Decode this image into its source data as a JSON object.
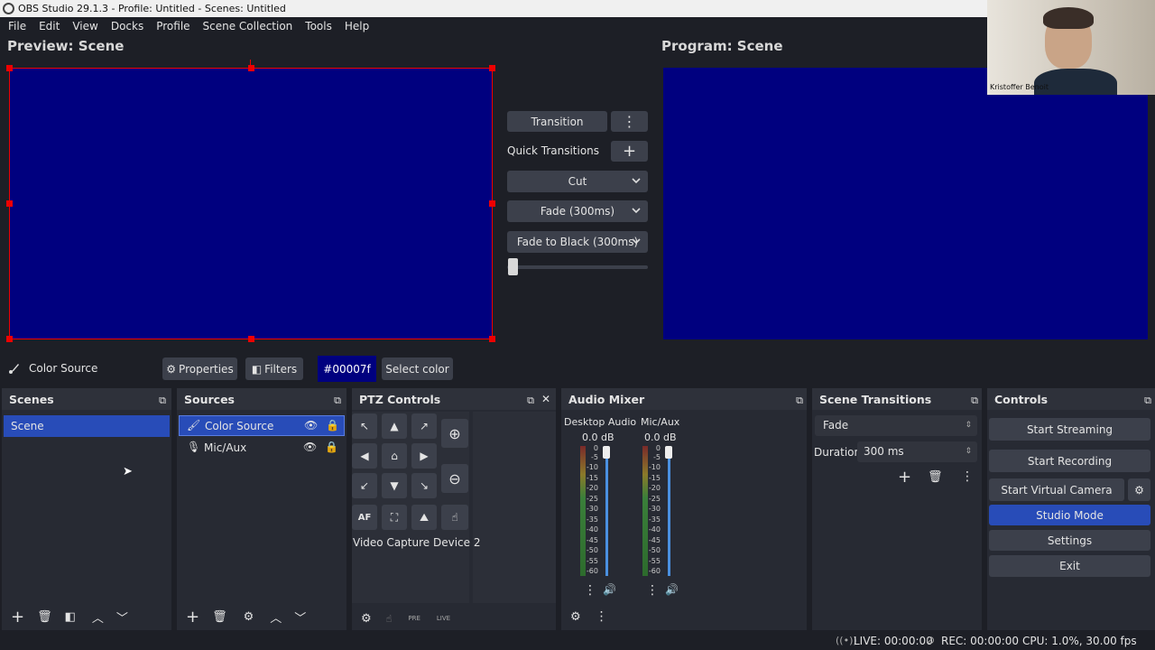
{
  "window": {
    "title": "OBS Studio 29.1.3 - Profile: Untitled - Scenes: Untitled"
  },
  "menu": [
    "File",
    "Edit",
    "View",
    "Docks",
    "Profile",
    "Scene Collection",
    "Tools",
    "Help"
  ],
  "preview": {
    "label": "Preview: Scene",
    "color": "#00007f"
  },
  "program": {
    "label": "Program: Scene",
    "color": "#00007f"
  },
  "transition_panel": {
    "transition_label": "Transition",
    "quick_label": "Quick Transitions",
    "cut": "Cut",
    "fade": "Fade (300ms)",
    "fade_black": "Fade to Black (300ms)"
  },
  "webcam": {
    "name": "Kristoffer Benoit"
  },
  "source_toolbar": {
    "source_name": "Color Source",
    "properties": "Properties",
    "filters": "Filters",
    "color_value": "#00007f",
    "select_color": "Select color"
  },
  "docks": {
    "scenes": {
      "title": "Scenes",
      "items": [
        "Scene"
      ]
    },
    "sources": {
      "title": "Sources",
      "items": [
        "Color Source",
        "Mic/Aux"
      ]
    },
    "ptz": {
      "title": "PTZ Controls",
      "device": "Video Capture Device 2",
      "pre": "PRE",
      "live": "LIVE",
      "af": "AF"
    },
    "audio": {
      "title": "Audio Mixer",
      "channels": [
        {
          "name": "Desktop Audio",
          "db": "0.0 dB"
        },
        {
          "name": "Mic/Aux",
          "db": "0.0 dB"
        }
      ],
      "ticks": [
        "0",
        "-5",
        "-10",
        "-15",
        "-20",
        "-25",
        "-30",
        "-35",
        "-40",
        "-45",
        "-50",
        "-55",
        "-60"
      ]
    },
    "transitions": {
      "title": "Scene Transitions",
      "selected": "Fade",
      "duration_label": "Duration",
      "duration_value": "300 ms"
    },
    "controls": {
      "title": "Controls",
      "start_streaming": "Start Streaming",
      "start_recording": "Start Recording",
      "start_virtual_camera": "Start Virtual Camera",
      "studio_mode": "Studio Mode",
      "settings": "Settings",
      "exit": "Exit"
    }
  },
  "status": {
    "live": "LIVE: 00:00:00",
    "rec": "REC: 00:00:00",
    "cpu": "CPU: 1.0%, 30.00 fps"
  },
  "colors": {
    "accent": "#284cb8",
    "preview_border": "#e00000"
  }
}
